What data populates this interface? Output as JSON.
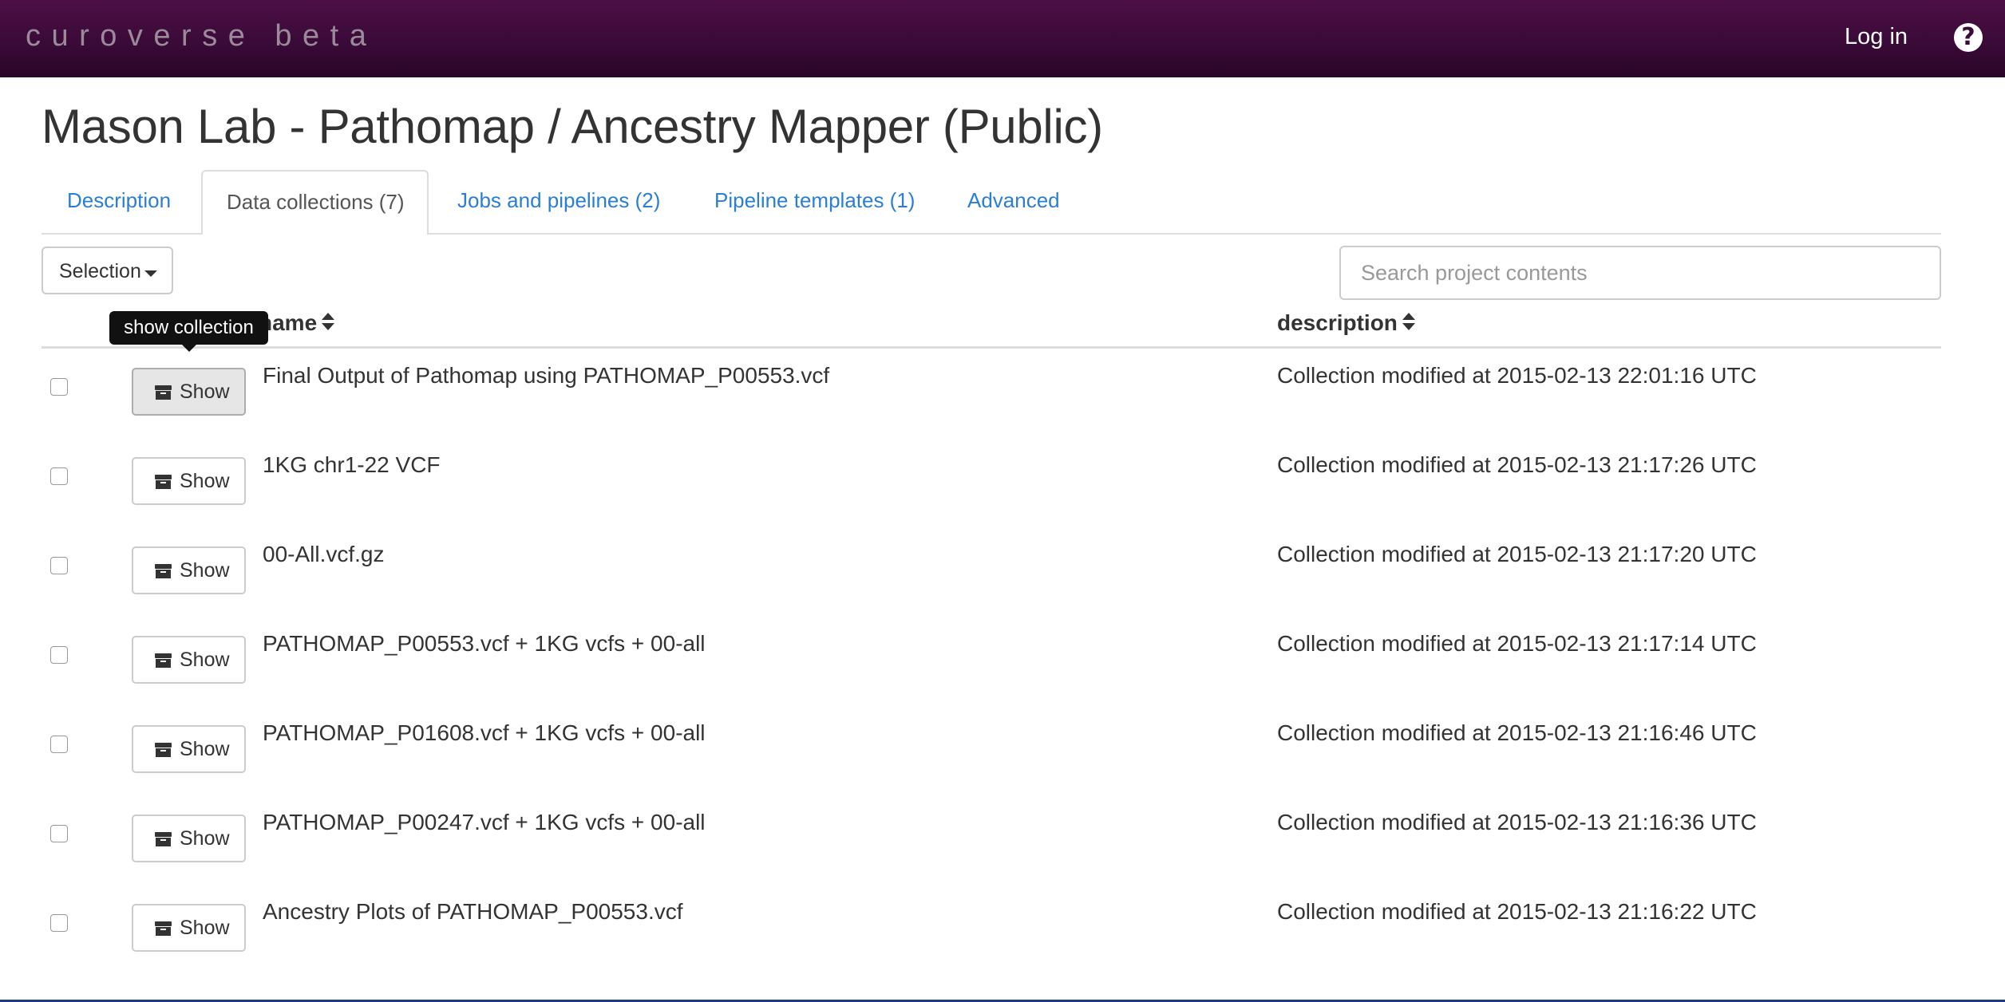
{
  "navbar": {
    "brand": "curoverse beta",
    "login_label": "Log in",
    "help_icon": "question-circle-icon"
  },
  "page": {
    "title": "Mason Lab - Pathomap / Ancestry Mapper (Public)"
  },
  "tabs": [
    {
      "label": "Description",
      "active": false
    },
    {
      "label": "Data collections (7)",
      "active": true
    },
    {
      "label": "Jobs and pipelines (2)",
      "active": false
    },
    {
      "label": "Pipeline templates (1)",
      "active": false
    },
    {
      "label": "Advanced",
      "active": false
    }
  ],
  "toolbar": {
    "selection_label": "Selection"
  },
  "search": {
    "placeholder": "Search project contents",
    "value": ""
  },
  "table": {
    "headers": {
      "name": "name",
      "description": "description"
    },
    "show_label": "Show",
    "show_icon": "archive-icon",
    "rows": [
      {
        "name": "Final Output of Pathomap using PATHOMAP_P00553.vcf",
        "description": "Collection modified at 2015-02-13 22:01:16 UTC"
      },
      {
        "name": "1KG chr1-22 VCF",
        "description": "Collection modified at 2015-02-13 21:17:26 UTC"
      },
      {
        "name": "00-All.vcf.gz",
        "description": "Collection modified at 2015-02-13 21:17:20 UTC"
      },
      {
        "name": "PATHOMAP_P00553.vcf + 1KG vcfs + 00-all",
        "description": "Collection modified at 2015-02-13 21:17:14 UTC"
      },
      {
        "name": "PATHOMAP_P01608.vcf + 1KG vcfs + 00-all",
        "description": "Collection modified at 2015-02-13 21:16:46 UTC"
      },
      {
        "name": "PATHOMAP_P00247.vcf + 1KG vcfs + 00-all",
        "description": "Collection modified at 2015-02-13 21:16:36 UTC"
      },
      {
        "name": "Ancestry Plots of PATHOMAP_P00553.vcf",
        "description": "Collection modified at 2015-02-13 21:16:22 UTC"
      }
    ]
  },
  "tooltip": {
    "text": "show collection"
  },
  "colors": {
    "navbar": "#3a0a38",
    "link": "#2a7fd4",
    "text": "#333333"
  }
}
